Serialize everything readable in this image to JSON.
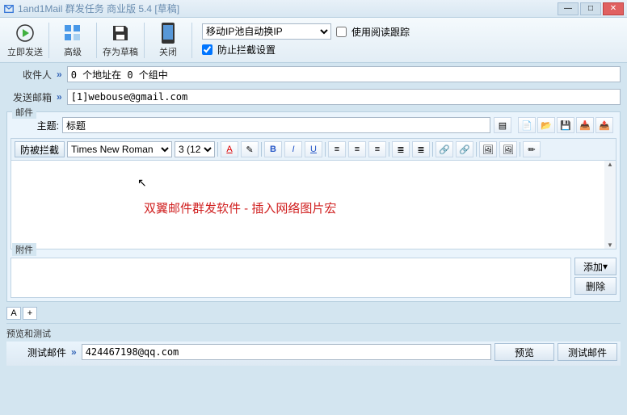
{
  "titlebar": {
    "title": "1and1Mail 群发任务 商业版 5.4 [草稿]"
  },
  "toolbar": {
    "send": "立即发送",
    "advanced": "高级",
    "save": "存为草稿",
    "close": "关闭",
    "ip_select": "移动IP池自动换IP",
    "read_track": "使用阅读跟踪",
    "block_setting": "防止拦截设置"
  },
  "form": {
    "recipient_label": "收件人",
    "recipient_value": "0 个地址在 0 个组中",
    "sender_label": "发送邮箱",
    "sender_value": "[1]webouse@gmail.com"
  },
  "mail": {
    "group": "邮件",
    "subject_label": "主题:",
    "subject_value": "标题",
    "antiblock": "防被拦截",
    "font": "Times New Roman",
    "size": "3 (12",
    "body": "双翼邮件群发软件 - 插入网络图片宏"
  },
  "attach": {
    "group": "附件",
    "add": "添加",
    "delete": "删除"
  },
  "tabs": {
    "a": "A",
    "plus": "+"
  },
  "preview": {
    "group": "预览和测试",
    "test_label": "测试邮件",
    "test_value": "424467198@qq.com",
    "preview_btn": "预览",
    "testsend_btn": "测试邮件"
  }
}
